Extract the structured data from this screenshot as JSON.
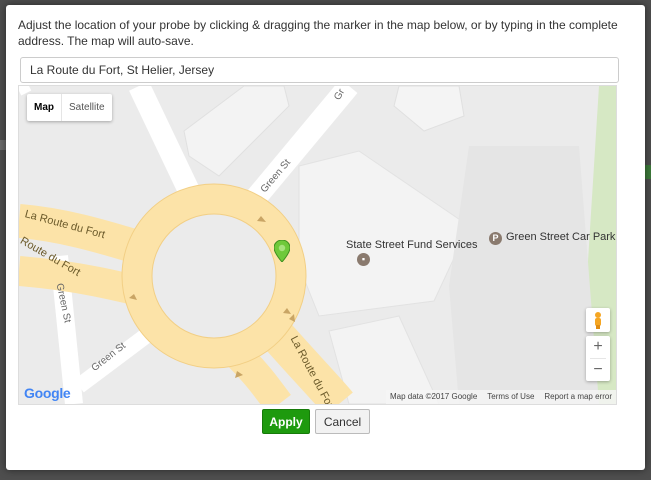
{
  "dialog": {
    "instructions": "Adjust the location of your probe by clicking & dragging the marker in the map below, or by typing in the complete address. The map will auto-save."
  },
  "address": {
    "value": "La Route du Fort, St Helier, Jersey"
  },
  "map": {
    "type_tabs": [
      {
        "label": "Map",
        "active": true
      },
      {
        "label": "Satellite",
        "active": false
      }
    ],
    "places": {
      "state_street": "State Street Fund Services",
      "car_park": "Green Street Car Park",
      "car_park_letter": "P"
    },
    "roads": {
      "route_du_fort_1": "La Route du Fort",
      "route_du_fort_2": "Route du Fort",
      "route_du_fort_3": "La Route du Fort",
      "green_st_1": "Green St",
      "green_st_2": "Green St",
      "green_st_3": "Green St",
      "green_st_partial": "Gr"
    },
    "zoom": {
      "in": "+",
      "out": "−"
    },
    "logo": "Google",
    "footer": {
      "data": "Map data ©2017 Google",
      "terms": "Terms of Use",
      "report": "Report a map error"
    },
    "colors": {
      "road_major": "#fce3a8",
      "road_minor": "#ffffff",
      "building": "#f0f0f0",
      "park": "#d6e8c4",
      "marker": "#6fc93a"
    }
  },
  "buttons": {
    "apply": "Apply",
    "cancel": "Cancel"
  }
}
